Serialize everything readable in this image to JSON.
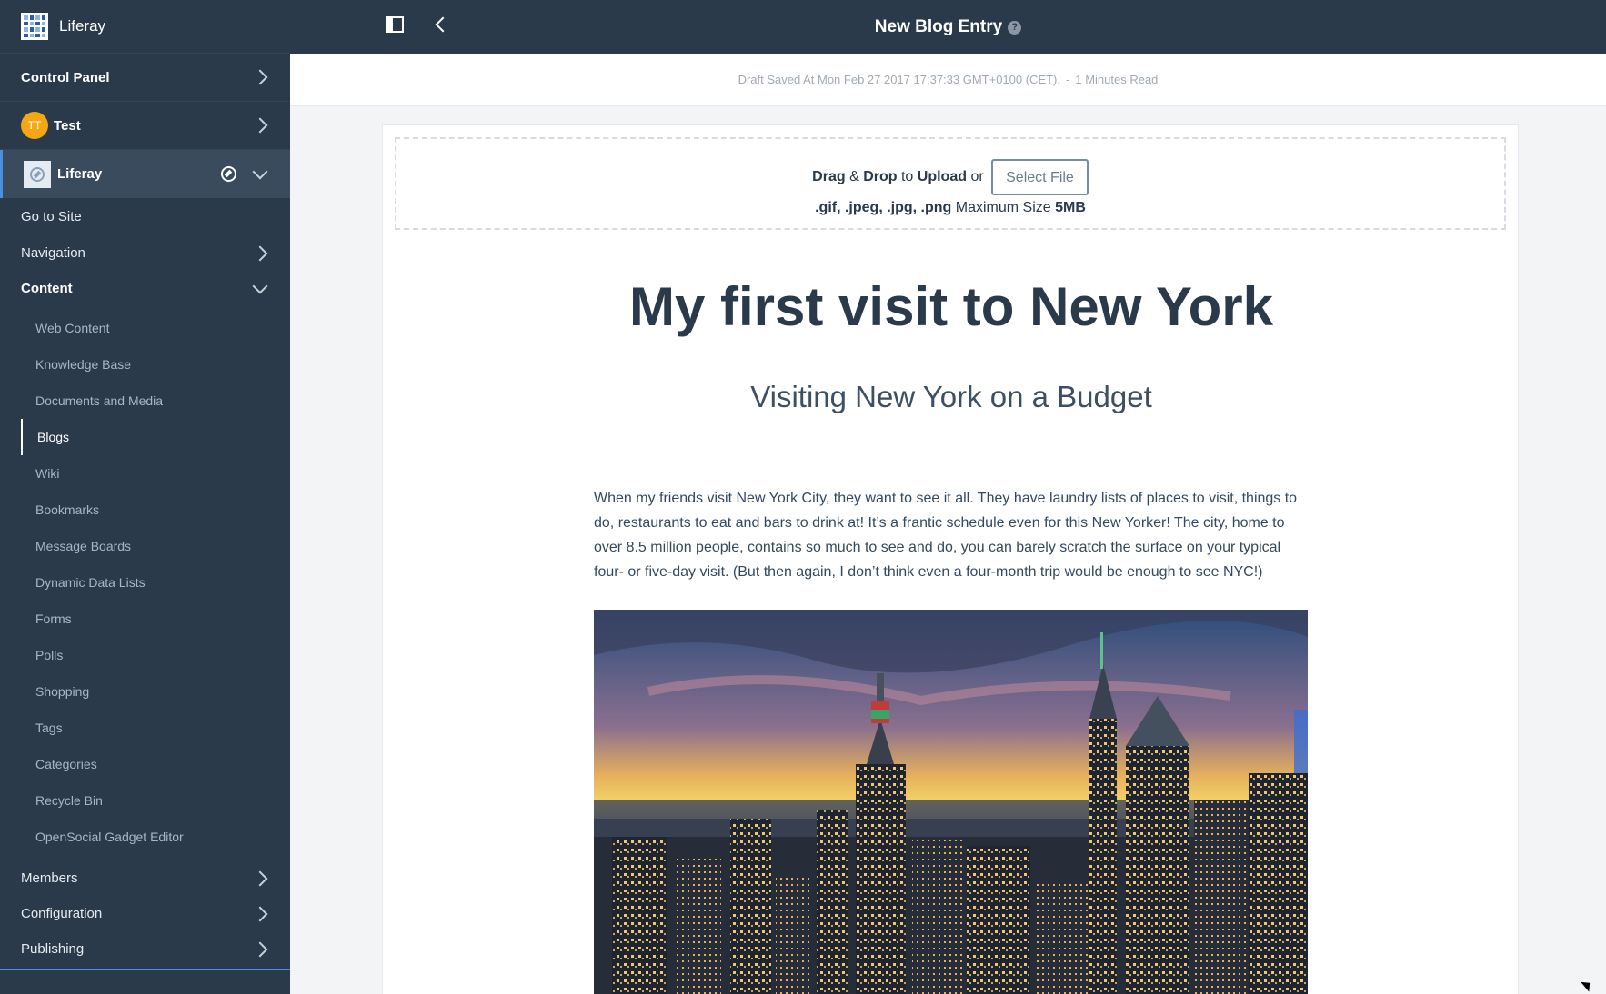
{
  "brand": {
    "name": "Liferay"
  },
  "sidebar": {
    "control_panel": "Control Panel",
    "user": {
      "initials": "TT",
      "name": "Test"
    },
    "site": {
      "name": "Liferay"
    },
    "go_to_site": "Go to Site",
    "navigation": "Navigation",
    "content": "Content",
    "content_items": [
      "Web Content",
      "Knowledge Base",
      "Documents and Media",
      "Blogs",
      "Wiki",
      "Bookmarks",
      "Message Boards",
      "Dynamic Data Lists",
      "Forms",
      "Polls",
      "Shopping",
      "Tags",
      "Categories",
      "Recycle Bin",
      "OpenSocial Gadget Editor"
    ],
    "active_item": "Blogs",
    "members": "Members",
    "configuration": "Configuration",
    "publishing": "Publishing"
  },
  "header": {
    "title": "New Blog Entry",
    "help": "?"
  },
  "status": {
    "draft": "Draft Saved At Mon Feb 27 2017 17:37:33 GMT+0100 (CET).",
    "separator": "-",
    "read_time": "1 Minutes Read"
  },
  "upload": {
    "drag": "Drag",
    "amp": "&",
    "drop": "Drop",
    "to": "to",
    "upload": "Upload",
    "or": "or",
    "select_file": "Select File",
    "formats": ".gif, .jpeg, .jpg, .png",
    "max_label": "Maximum Size",
    "max_size": "5MB"
  },
  "entry": {
    "title": "My first visit to New York",
    "subtitle": "Visiting New York on a Budget",
    "body": "When my friends visit New York City, they want to see it all. They have laundry lists of places to visit, things to do, restaurants to eat and bars to drink at! It’s a frantic schedule even for this New Yorker! The city, home to over 8.5 million people, contains so much to see and do, you can barely scratch the surface on your typical four- or five-day visit. (But then again, I don’t think even a four-month trip would be enough to see NYC!)"
  },
  "colors": {
    "sidebar": "#2b3a4a",
    "accent": "#4a90e2",
    "avatar": "#f3a712"
  }
}
